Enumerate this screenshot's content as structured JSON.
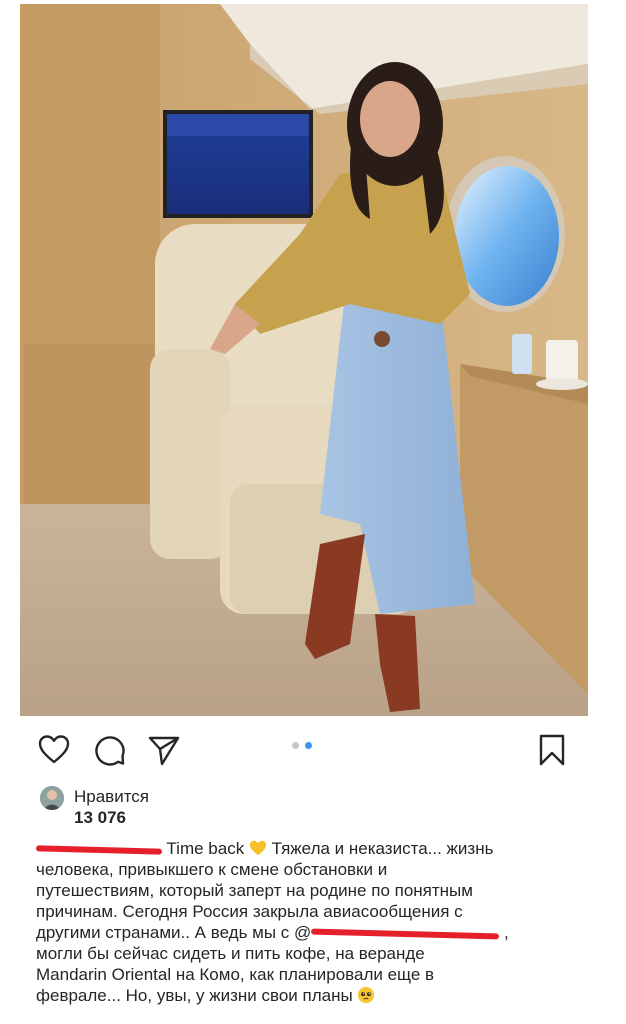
{
  "post": {
    "image_alt": "",
    "carousel_dots": 2,
    "carousel_active": 2
  },
  "actions": {
    "like_icon": "heart-icon",
    "comment_icon": "comment-icon",
    "share_icon": "paper-plane-icon",
    "save_icon": "bookmark-icon"
  },
  "likes": {
    "label": "Нравится",
    "count": "13 076"
  },
  "caption": {
    "l1_text": "Time back",
    "l1_tail": "Тяжела и неказиста... жизнь",
    "l2": "человека, привыкшего к смене обстановки и",
    "l3": "путешествиям, который заперт на родине по понятным",
    "l4": "причинам. Сегодня Россия закрыла авиасообщения с",
    "l5_text": "другими странами.. А ведь мы с @",
    "l5_tail": ",",
    "l6": "могли бы сейчас сидеть и пить кофе, на веранде",
    "l7": "Mandarin Oriental на Комо, как планировали еще в",
    "l8": "феврале... Но, увы, у жизни свои планы",
    "emoji_heart": "yellow-heart-icon",
    "emoji_face": "pleading-face-icon"
  },
  "colors": {
    "accent_dot": "#3897f0",
    "redaction": "#e5202a",
    "text": "#262626"
  }
}
